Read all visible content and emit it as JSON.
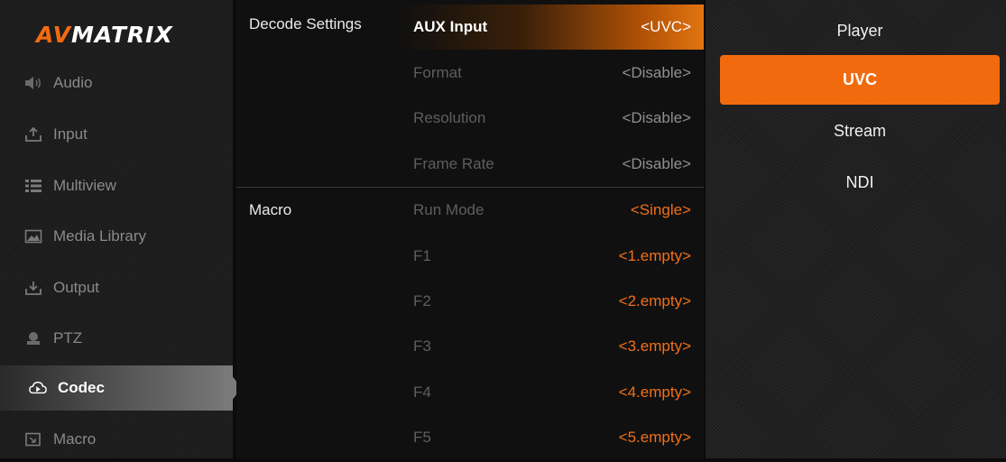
{
  "brand": {
    "logo_accent": "AV",
    "logo_rest": "MATRIX",
    "accent_color": "#f26b10"
  },
  "sidebar": {
    "items": [
      {
        "label": "Audio",
        "icon": "speaker-icon"
      },
      {
        "label": "Input",
        "icon": "upload-icon"
      },
      {
        "label": "Multiview",
        "icon": "grid-list-icon"
      },
      {
        "label": "Media Library",
        "icon": "image-icon"
      },
      {
        "label": "Output",
        "icon": "download-icon"
      },
      {
        "label": "PTZ",
        "icon": "camera-icon"
      },
      {
        "label": "Codec",
        "icon": "cloud-play-icon",
        "active": true
      },
      {
        "label": "Macro",
        "icon": "macro-icon"
      }
    ]
  },
  "settings": {
    "decode_group_label": "Decode Settings",
    "macro_group_label": "Macro",
    "decode_rows": [
      {
        "label": "AUX Input",
        "value": "<UVC>"
      },
      {
        "label": "Format",
        "value": "<Disable>"
      },
      {
        "label": "Resolution",
        "value": "<Disable>"
      },
      {
        "label": "Frame Rate",
        "value": "<Disable>"
      }
    ],
    "macro_rows": [
      {
        "label": "Run Mode",
        "value": "<Single>"
      },
      {
        "label": "F1",
        "value": "<1.empty>"
      },
      {
        "label": "F2",
        "value": "<2.empty>"
      },
      {
        "label": "F3",
        "value": "<3.empty>"
      },
      {
        "label": "F4",
        "value": "<4.empty>"
      },
      {
        "label": "F5",
        "value": "<5.empty>"
      }
    ]
  },
  "options": {
    "items": [
      {
        "label": "Player"
      },
      {
        "label": "UVC",
        "selected": true
      },
      {
        "label": "Stream"
      },
      {
        "label": "NDI"
      }
    ]
  }
}
